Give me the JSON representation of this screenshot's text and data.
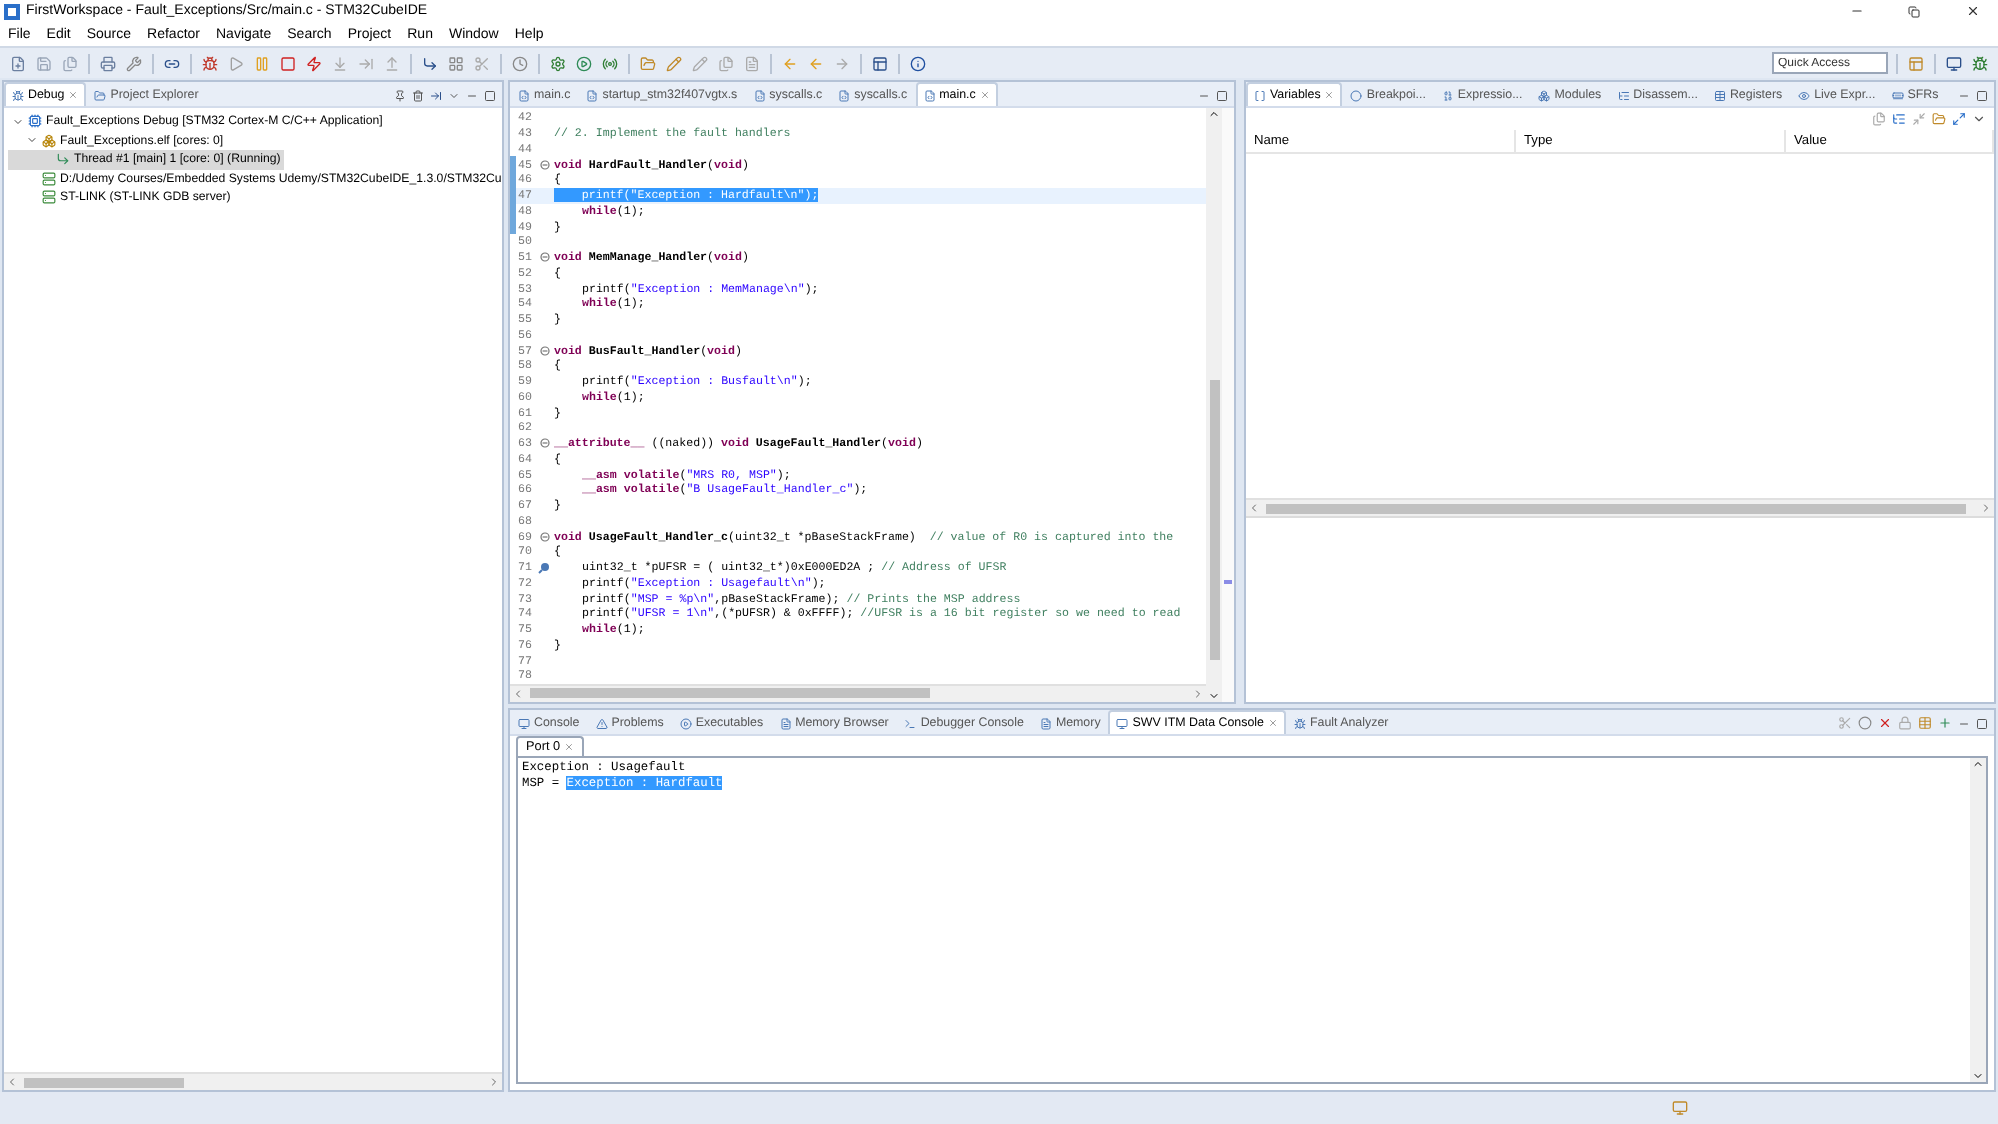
{
  "window": {
    "title": "FirstWorkspace - Fault_Exceptions/Src/main.c - STM32CubeIDE"
  },
  "menu": [
    "File",
    "Edit",
    "Source",
    "Refactor",
    "Navigate",
    "Search",
    "Project",
    "Run",
    "Window",
    "Help"
  ],
  "quick_access": {
    "placeholder": "Quick Access"
  },
  "debug_view": {
    "tabs": [
      {
        "label": "Debug",
        "selected": true
      },
      {
        "label": "Project Explorer",
        "selected": false
      }
    ],
    "tree": [
      {
        "label": "Fault_Exceptions Debug [STM32 Cortex-M C/C++ Application]",
        "kind": "launch",
        "selected": false,
        "expanded": true,
        "children": [
          {
            "label": "Fault_Exceptions.elf [cores: 0]",
            "kind": "process",
            "selected": false,
            "expanded": true,
            "children": [
              {
                "label": "Thread #1 [main] 1 [core: 0] (Running)",
                "kind": "thread",
                "selected": true
              }
            ]
          },
          {
            "label": "D:/Udemy Courses/Embedded Systems Udemy/STM32CubeIDE_1.3.0/STM32Cu",
            "kind": "path",
            "selected": false
          },
          {
            "label": "ST-LINK (ST-LINK GDB server)",
            "kind": "path",
            "selected": false
          }
        ]
      }
    ]
  },
  "editor": {
    "tabs": [
      {
        "label": "main.c",
        "selected": false
      },
      {
        "label": "startup_stm32f407vgtx.s",
        "selected": false
      },
      {
        "label": "syscalls.c",
        "selected": false
      },
      {
        "label": "syscalls.c",
        "selected": false
      },
      {
        "label": "main.c",
        "selected": true
      }
    ],
    "lines": [
      {
        "n": "42",
        "fold": false,
        "marked": false,
        "breakpoint": false,
        "selected": false
      },
      {
        "n": "43",
        "fold": false,
        "marked": false,
        "breakpoint": false,
        "selected": false,
        "indented": false,
        "tokens": [
          {
            "kind": "cmt",
            "text": "// 2. Implement the fault handlers"
          }
        ]
      },
      {
        "n": "44",
        "fold": false,
        "marked": false,
        "breakpoint": false,
        "selected": false
      },
      {
        "n": "45",
        "fold": true,
        "marked": true,
        "breakpoint": false,
        "selected": false,
        "indented": false,
        "tokens": [
          {
            "kind": "kw",
            "text": "void"
          },
          {
            "kind": "fn",
            "text": " HardFault_Handler"
          },
          {
            "kind": "p",
            "text": "("
          },
          {
            "kind": "kw",
            "text": "void"
          },
          {
            "kind": "p",
            "text": ")"
          }
        ]
      },
      {
        "n": "46",
        "fold": false,
        "marked": true,
        "breakpoint": false,
        "selected": false,
        "indented": false,
        "tokens": [
          {
            "kind": "p",
            "text": "{"
          }
        ]
      },
      {
        "n": "47",
        "fold": false,
        "marked": true,
        "breakpoint": false,
        "selected": true,
        "indented": false,
        "tokens": [
          {
            "kind": "selection",
            "text": "    printf(\"Exception : Hardfault\\n\");"
          }
        ]
      },
      {
        "n": "48",
        "fold": false,
        "marked": true,
        "breakpoint": false,
        "selected": false,
        "indented": true,
        "tokens": [
          {
            "kind": "kw",
            "text": "while"
          },
          {
            "kind": "p",
            "text": "(1);"
          }
        ]
      },
      {
        "n": "49",
        "fold": false,
        "marked": true,
        "breakpoint": false,
        "selected": false,
        "indented": false,
        "tokens": [
          {
            "kind": "p",
            "text": "}"
          }
        ]
      },
      {
        "n": "50",
        "fold": false,
        "marked": false,
        "breakpoint": false,
        "selected": false
      },
      {
        "n": "51",
        "fold": true,
        "marked": false,
        "breakpoint": false,
        "selected": false,
        "indented": false,
        "tokens": [
          {
            "kind": "kw",
            "text": "void"
          },
          {
            "kind": "fn",
            "text": " MemManage_Handler"
          },
          {
            "kind": "p",
            "text": "("
          },
          {
            "kind": "kw",
            "text": "void"
          },
          {
            "kind": "p",
            "text": ")"
          }
        ]
      },
      {
        "n": "52",
        "fold": false,
        "marked": false,
        "breakpoint": false,
        "selected": false,
        "indented": false,
        "tokens": [
          {
            "kind": "p",
            "text": "{"
          }
        ]
      },
      {
        "n": "53",
        "fold": false,
        "marked": false,
        "breakpoint": false,
        "selected": false,
        "indented": true,
        "tokens": [
          {
            "kind": "p",
            "text": "printf("
          },
          {
            "kind": "str",
            "text": "\"Exception : MemManage\\n\""
          },
          {
            "kind": "p",
            "text": ");"
          }
        ]
      },
      {
        "n": "54",
        "fold": false,
        "marked": false,
        "breakpoint": false,
        "selected": false,
        "indented": true,
        "tokens": [
          {
            "kind": "kw",
            "text": "while"
          },
          {
            "kind": "p",
            "text": "(1);"
          }
        ]
      },
      {
        "n": "55",
        "fold": false,
        "marked": false,
        "breakpoint": false,
        "selected": false,
        "indented": false,
        "tokens": [
          {
            "kind": "p",
            "text": "}"
          }
        ]
      },
      {
        "n": "56",
        "fold": false,
        "marked": false,
        "breakpoint": false,
        "selected": false
      },
      {
        "n": "57",
        "fold": true,
        "marked": false,
        "breakpoint": false,
        "selected": false,
        "indented": false,
        "tokens": [
          {
            "kind": "kw",
            "text": "void"
          },
          {
            "kind": "fn",
            "text": " BusFault_Handler"
          },
          {
            "kind": "p",
            "text": "("
          },
          {
            "kind": "kw",
            "text": "void"
          },
          {
            "kind": "p",
            "text": ")"
          }
        ]
      },
      {
        "n": "58",
        "fold": false,
        "marked": false,
        "breakpoint": false,
        "selected": false,
        "indented": false,
        "tokens": [
          {
            "kind": "p",
            "text": "{"
          }
        ]
      },
      {
        "n": "59",
        "fold": false,
        "marked": false,
        "breakpoint": false,
        "selected": false,
        "indented": true,
        "tokens": [
          {
            "kind": "p",
            "text": "printf("
          },
          {
            "kind": "str",
            "text": "\"Exception : Busfault\\n\""
          },
          {
            "kind": "p",
            "text": ");"
          }
        ]
      },
      {
        "n": "60",
        "fold": false,
        "marked": false,
        "breakpoint": false,
        "selected": false,
        "indented": true,
        "tokens": [
          {
            "kind": "kw",
            "text": "while"
          },
          {
            "kind": "p",
            "text": "(1);"
          }
        ]
      },
      {
        "n": "61",
        "fold": false,
        "marked": false,
        "breakpoint": false,
        "selected": false,
        "indented": false,
        "tokens": [
          {
            "kind": "p",
            "text": "}"
          }
        ]
      },
      {
        "n": "62",
        "fold": false,
        "marked": false,
        "breakpoint": false,
        "selected": false
      },
      {
        "n": "63",
        "fold": true,
        "marked": false,
        "breakpoint": false,
        "selected": false,
        "indented": false,
        "tokens": [
          {
            "kind": "kw",
            "text": "__attribute__"
          },
          {
            "kind": "p",
            "text": " ((naked)) "
          },
          {
            "kind": "kw",
            "text": "void"
          },
          {
            "kind": "fn",
            "text": " UsageFault_Handler"
          },
          {
            "kind": "p",
            "text": "("
          },
          {
            "kind": "kw",
            "text": "void"
          },
          {
            "kind": "p",
            "text": ")"
          }
        ]
      },
      {
        "n": "64",
        "fold": false,
        "marked": false,
        "breakpoint": false,
        "selected": false,
        "indented": false,
        "tokens": [
          {
            "kind": "p",
            "text": "{"
          }
        ]
      },
      {
        "n": "65",
        "fold": false,
        "marked": false,
        "breakpoint": false,
        "selected": false,
        "indented": true,
        "tokens": [
          {
            "kind": "kw",
            "text": "__asm volatile"
          },
          {
            "kind": "p",
            "text": "("
          },
          {
            "kind": "str",
            "text": "\"MRS R0, MSP\""
          },
          {
            "kind": "p",
            "text": ");"
          }
        ]
      },
      {
        "n": "66",
        "fold": false,
        "marked": false,
        "breakpoint": false,
        "selected": false,
        "indented": true,
        "tokens": [
          {
            "kind": "kw",
            "text": "__asm volatile"
          },
          {
            "kind": "p",
            "text": "("
          },
          {
            "kind": "str",
            "text": "\"B UsageFault_Handler_c\""
          },
          {
            "kind": "p",
            "text": ");"
          }
        ]
      },
      {
        "n": "67",
        "fold": false,
        "marked": false,
        "breakpoint": false,
        "selected": false,
        "indented": false,
        "tokens": [
          {
            "kind": "p",
            "text": "}"
          }
        ]
      },
      {
        "n": "68",
        "fold": false,
        "marked": false,
        "breakpoint": false,
        "selected": false
      },
      {
        "n": "69",
        "fold": true,
        "marked": false,
        "breakpoint": false,
        "selected": false,
        "indented": false,
        "tokens": [
          {
            "kind": "kw",
            "text": "void"
          },
          {
            "kind": "fn",
            "text": " UsageFault_Handler_c"
          },
          {
            "kind": "p",
            "text": "(uint32_t *pBaseStackFrame)  "
          },
          {
            "kind": "cmt",
            "text": "// value of R0 is captured into the"
          }
        ]
      },
      {
        "n": "70",
        "fold": false,
        "marked": false,
        "breakpoint": false,
        "selected": false,
        "indented": false,
        "tokens": [
          {
            "kind": "p",
            "text": "{"
          }
        ]
      },
      {
        "n": "71",
        "fold": false,
        "marked": false,
        "breakpoint": true,
        "selected": false,
        "indented": true,
        "tokens": [
          {
            "kind": "p",
            "text": "uint32_t *pUFSR = ( uint32_t*)0xE000ED2A ; "
          },
          {
            "kind": "cmt",
            "text": "// Address of UFSR"
          }
        ]
      },
      {
        "n": "72",
        "fold": false,
        "marked": false,
        "breakpoint": false,
        "selected": false,
        "indented": true,
        "tokens": [
          {
            "kind": "p",
            "text": "printf("
          },
          {
            "kind": "str",
            "text": "\"Exception : Usagefault\\n\""
          },
          {
            "kind": "p",
            "text": ");"
          }
        ]
      },
      {
        "n": "73",
        "fold": false,
        "marked": false,
        "breakpoint": false,
        "selected": false,
        "indented": true,
        "tokens": [
          {
            "kind": "p",
            "text": "printf("
          },
          {
            "kind": "str",
            "text": "\"MSP = %p\\n\""
          },
          {
            "kind": "p",
            "text": ",pBaseStackFrame); "
          },
          {
            "kind": "cmt",
            "text": "// Prints the MSP address"
          }
        ]
      },
      {
        "n": "74",
        "fold": false,
        "marked": false,
        "breakpoint": false,
        "selected": false,
        "indented": true,
        "tokens": [
          {
            "kind": "p",
            "text": "printf("
          },
          {
            "kind": "str",
            "text": "\"UFSR = 1\\n\""
          },
          {
            "kind": "p",
            "text": ",(*pUFSR) & 0xFFFF); "
          },
          {
            "kind": "cmt",
            "text": "//UFSR is a 16 bit register so we need to read"
          }
        ]
      },
      {
        "n": "75",
        "fold": false,
        "marked": false,
        "breakpoint": false,
        "selected": false,
        "indented": true,
        "tokens": [
          {
            "kind": "kw",
            "text": "while"
          },
          {
            "kind": "p",
            "text": "(1);"
          }
        ]
      },
      {
        "n": "76",
        "fold": false,
        "marked": false,
        "breakpoint": false,
        "selected": false,
        "indented": false,
        "tokens": [
          {
            "kind": "p",
            "text": "}"
          }
        ]
      },
      {
        "n": "77",
        "fold": false,
        "marked": false,
        "breakpoint": false,
        "selected": false
      },
      {
        "n": "78",
        "fold": false,
        "marked": false,
        "breakpoint": false,
        "selected": false
      }
    ]
  },
  "variables_view": {
    "tabs": [
      {
        "label": "Variables",
        "selected": true
      },
      {
        "label": "Breakpoi...",
        "selected": false
      },
      {
        "label": "Expressio...",
        "selected": false
      },
      {
        "label": "Modules",
        "selected": false
      },
      {
        "label": "Disassem...",
        "selected": false
      },
      {
        "label": "Registers",
        "selected": false
      },
      {
        "label": "Live Expr...",
        "selected": false
      },
      {
        "label": "SFRs",
        "selected": false
      }
    ],
    "columns": [
      "Name",
      "Type",
      "Value"
    ]
  },
  "console_view": {
    "tabs": [
      {
        "label": "Console",
        "selected": false
      },
      {
        "label": "Problems",
        "selected": false
      },
      {
        "label": "Executables",
        "selected": false
      },
      {
        "label": "Memory Browser",
        "selected": false
      },
      {
        "label": "Debugger Console",
        "selected": false
      },
      {
        "label": "Memory",
        "selected": false
      },
      {
        "label": "SWV ITM Data Console",
        "selected": true
      },
      {
        "label": "Fault Analyzer",
        "selected": false
      }
    ],
    "port_tab": {
      "label": "Port 0"
    },
    "lines": [
      [
        {
          "kind": "p",
          "text": "Exception : Usagefault"
        }
      ],
      [
        {
          "kind": "p",
          "text": "MSP = "
        },
        {
          "kind": "selection",
          "text": "Exception : Hardfault"
        }
      ]
    ]
  }
}
